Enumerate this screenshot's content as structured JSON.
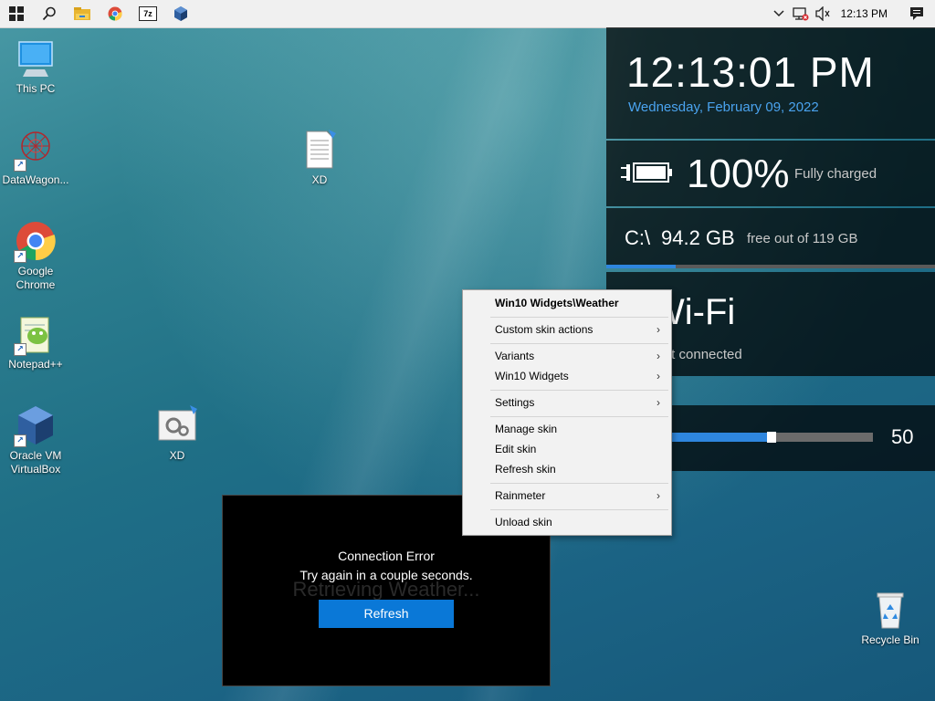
{
  "taskbar": {
    "start_icon": "windows-start-icon",
    "search_icon": "search-icon",
    "pinned": [
      {
        "name": "file-explorer-icon"
      },
      {
        "name": "chrome-icon"
      },
      {
        "name": "7zip-icon",
        "label": "7z"
      },
      {
        "name": "virtualbox-icon"
      }
    ],
    "tray": {
      "chevron_icon": "chevron-up-icon",
      "network_icon": "network-disconnected-icon",
      "volume_icon": "volume-icon",
      "clock": "12:13 PM",
      "notification_icon": "action-center-icon"
    }
  },
  "desktop_icons": [
    {
      "label": "This PC",
      "icon": "this-pc-icon"
    },
    {
      "label": "DataWagon...",
      "icon": "datawagon-icon"
    },
    {
      "label": "Google Chrome",
      "icon": "chrome-icon"
    },
    {
      "label": "Notepad++",
      "icon": "notepadpp-icon"
    },
    {
      "label": "Oracle VM VirtualBox",
      "icon": "virtualbox-icon"
    },
    {
      "label": "XD",
      "icon": "document-icon"
    },
    {
      "label": "XD",
      "icon": "settings-file-icon"
    },
    {
      "label": "Recycle Bin",
      "icon": "recycle-bin-icon"
    }
  ],
  "rainmeter": {
    "time": "12:13:01 PM",
    "date": "Wednesday, February 09, 2022",
    "battery_percent": "100%",
    "battery_status": "Fully charged",
    "disk_drive": "C:\\",
    "disk_free": "94.2 GB",
    "disk_total_text": "free out of 119 GB",
    "disk_used_fraction": 0.21,
    "wifi_title": "Wi-Fi",
    "wifi_status": "Not connected",
    "volume_value": "50",
    "volume_fraction": 0.5
  },
  "weather": {
    "ghost_text": "Retrieving Weather...",
    "error_line1": "Connection Error",
    "error_line2": "Try again in a couple seconds.",
    "refresh_label": "Refresh"
  },
  "context_menu": {
    "header": "Win10 Widgets\\Weather",
    "items": [
      {
        "label": "Custom skin actions",
        "submenu": true
      },
      {
        "label": "Variants",
        "submenu": true
      },
      {
        "label": "Win10 Widgets",
        "submenu": true
      },
      {
        "label": "Settings",
        "submenu": true
      },
      {
        "label": "Manage skin",
        "submenu": false
      },
      {
        "label": "Edit skin",
        "submenu": false
      },
      {
        "label": "Refresh skin",
        "submenu": false
      },
      {
        "label": "Rainmeter",
        "submenu": true
      },
      {
        "label": "Unload skin",
        "submenu": false
      }
    ],
    "submenu_arrow": "›"
  },
  "colors": {
    "accent": "#0a78d7",
    "date_blue": "#4aa3ef",
    "bar_blue": "#2e86de"
  }
}
